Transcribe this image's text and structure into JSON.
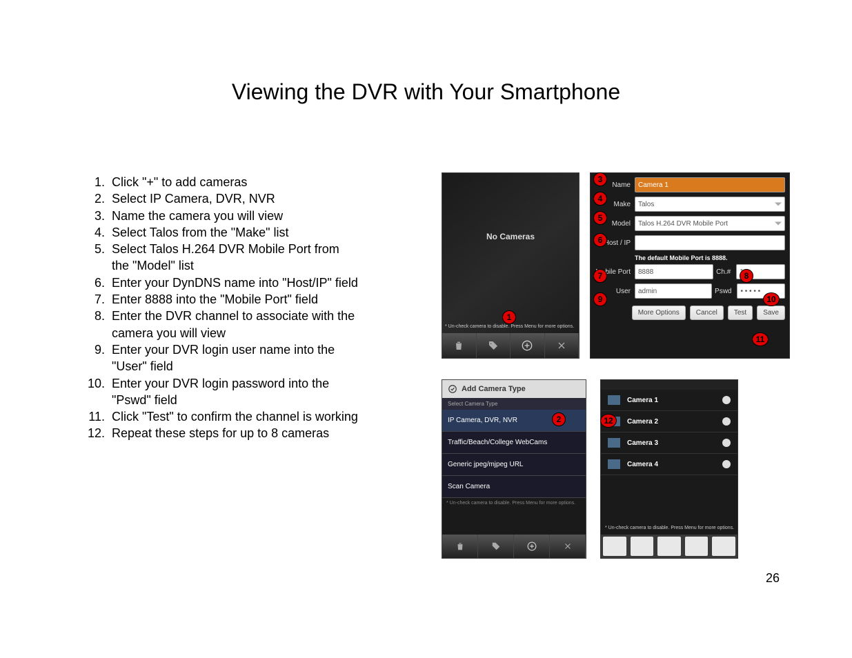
{
  "title": "Viewing the DVR with Your Smartphone",
  "page_number": "26",
  "instructions": [
    "Click \"+\" to add cameras",
    "Select IP Camera, DVR, NVR",
    "Name the camera you will view",
    "Select Talos from the \"Make\" list",
    "Select Talos H.264 DVR Mobile Port from the \"Model\" list",
    "Enter your DynDNS name into \"Host/IP\" field",
    "Enter 8888 into the \"Mobile Port\" field",
    "Enter the DVR channel to associate with the camera you will view",
    "Enter your DVR login user name into the \"User\" field",
    "Enter your DVR login password into the \"Pswd\" field",
    "Click \"Test\" to confirm the channel is working",
    "Repeat these steps for up to 8 cameras"
  ],
  "shot1": {
    "title": "No Cameras",
    "hint": "* Un-check camera to disable. Press Menu for more options."
  },
  "shot2": {
    "name_label": "Name",
    "name_value": "Camera 1",
    "make_label": "Make",
    "make_value": "Talos",
    "model_label": "Model",
    "model_value": "Talos H.264 DVR Mobile Port",
    "host_label": "Host / IP",
    "host_value": "",
    "port_hint": "The default Mobile Port is 8888.",
    "port_label": "Mobile Port",
    "port_value": "8888",
    "ch_label": "Ch.#",
    "ch_value": "1",
    "user_label": "User",
    "user_value": "admin",
    "pswd_label": "Pswd",
    "pswd_value": "• • • • •",
    "btn_more": "More Options",
    "btn_cancel": "Cancel",
    "btn_test": "Test",
    "btn_save": "Save"
  },
  "shot3": {
    "header": "Add Camera Type",
    "sub": "Select Camera Type",
    "items": [
      "IP Camera, DVR, NVR",
      "Traffic/Beach/College WebCams",
      "Generic jpeg/mjpeg URL",
      "Scan Camera"
    ],
    "hint": "* Un-check camera to disable. Press Menu for more options."
  },
  "shot4": {
    "status": "",
    "hint": "* Un-check camera to disable. Press Menu for more options.",
    "items": [
      "Camera 1",
      "Camera 2",
      "Camera 3",
      "Camera 4"
    ]
  },
  "callouts": [
    "1",
    "2",
    "3",
    "4",
    "5",
    "6",
    "7",
    "8",
    "9",
    "10",
    "11",
    "12"
  ]
}
